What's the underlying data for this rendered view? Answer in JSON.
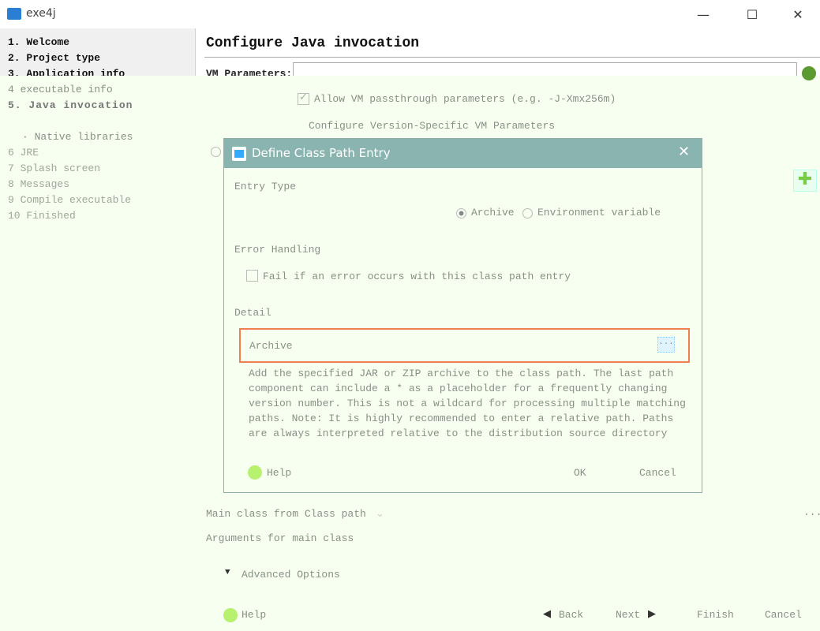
{
  "window": {
    "title": "exe4j",
    "minimize": "—",
    "maximize": "☐",
    "close": "✕"
  },
  "sidebar": {
    "items": [
      {
        "label": "1. Welcome"
      },
      {
        "label": "2. Project type"
      },
      {
        "label": "3. Application info"
      },
      {
        "label": "4 executable info"
      },
      {
        "label": "5. Java invocation"
      },
      {
        "label": "· Native libraries"
      },
      {
        "label": "6 JRE"
      },
      {
        "label": "7 Splash screen"
      },
      {
        "label": "8 Messages"
      },
      {
        "label": "9 Compile executable"
      },
      {
        "label": "10 Finished"
      }
    ]
  },
  "main": {
    "title": "Configure Java invocation",
    "vm_label": "VM Parameters:",
    "vm_value": "",
    "passthrough_label": "Allow VM passthrough parameters (e.g. -J-Xmx256m)",
    "passthrough_checked": true,
    "version_specific_label": "Configure Version-Specific VM Parameters",
    "main_class_label": "Main class from Class path",
    "main_class_more": "...",
    "arguments_label": "Arguments for main class",
    "advanced_label": "Advanced Options",
    "help_label": "Help",
    "back_label": "Back",
    "next_label": "Next",
    "finish_label": "Finish",
    "cancel_label": "Cancel"
  },
  "dialog": {
    "title": "Define Class Path Entry",
    "close": "✕",
    "entry_type_label": "Entry Type",
    "archive_option": "Archive",
    "env_option": "Environment variable",
    "selected": "Archive",
    "error_handling_label": "Error Handling",
    "fail_label": "Fail if an error occurs with this class path entry",
    "fail_checked": false,
    "detail_label": "Detail",
    "archive_field_label": "Archive",
    "browse_label": "...",
    "description": [
      "Add the specified JAR or ZIP archive to the class path. The last path",
      "component can include a * as a placeholder for a frequently changing",
      "version number. This is not a wildcard for processing multiple matching",
      "paths. Note: It is highly recommended to enter a relative path. Paths",
      "are always interpreted relative to the distribution source directory"
    ],
    "help_label": "Help",
    "ok_label": "OK",
    "cancel_label": "Cancel"
  },
  "colors": {
    "titlebar": "#8ab4b0",
    "highlight": "#f08050",
    "overlay": "#f6fff0"
  }
}
